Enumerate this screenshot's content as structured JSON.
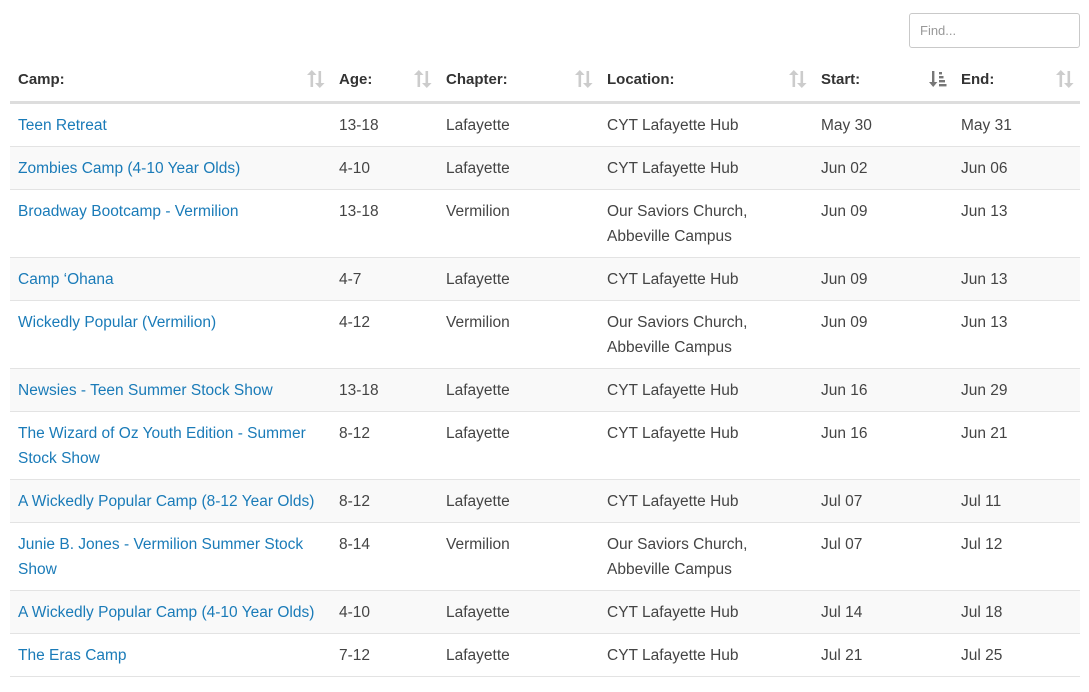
{
  "search": {
    "placeholder": "Find..."
  },
  "table": {
    "columns": [
      {
        "key": "camp",
        "label": "Camp:",
        "sort": "none"
      },
      {
        "key": "age",
        "label": "Age:",
        "sort": "none"
      },
      {
        "key": "chapter",
        "label": "Chapter:",
        "sort": "none"
      },
      {
        "key": "location",
        "label": "Location:",
        "sort": "none"
      },
      {
        "key": "start",
        "label": "Start:",
        "sort": "ascending"
      },
      {
        "key": "end",
        "label": "End:",
        "sort": "none"
      }
    ],
    "rows": [
      {
        "camp": "Teen Retreat",
        "age": "13-18",
        "chapter": "Lafayette",
        "location": "CYT Lafayette Hub",
        "start": "May 30",
        "end": "May 31"
      },
      {
        "camp": "Zombies Camp (4-10 Year Olds)",
        "age": "4-10",
        "chapter": "Lafayette",
        "location": "CYT Lafayette Hub",
        "start": "Jun 02",
        "end": "Jun 06"
      },
      {
        "camp": "Broadway Bootcamp - Vermilion",
        "age": "13-18",
        "chapter": "Vermilion",
        "location": "Our Saviors Church, Abbeville Campus",
        "start": "Jun 09",
        "end": "Jun 13"
      },
      {
        "camp": "Camp ‘Ohana",
        "age": "4-7",
        "chapter": "Lafayette",
        "location": "CYT Lafayette Hub",
        "start": "Jun 09",
        "end": "Jun 13"
      },
      {
        "camp": "Wickedly Popular (Vermilion)",
        "age": "4-12",
        "chapter": "Vermilion",
        "location": "Our Saviors Church, Abbeville Campus",
        "start": "Jun 09",
        "end": "Jun 13"
      },
      {
        "camp": "Newsies - Teen Summer Stock Show",
        "age": "13-18",
        "chapter": "Lafayette",
        "location": "CYT Lafayette Hub",
        "start": "Jun 16",
        "end": "Jun 29"
      },
      {
        "camp": "The Wizard of Oz Youth Edition - Summer Stock Show",
        "age": "8-12",
        "chapter": "Lafayette",
        "location": "CYT Lafayette Hub",
        "start": "Jun 16",
        "end": "Jun 21"
      },
      {
        "camp": "A Wickedly Popular Camp (8-12 Year Olds)",
        "age": "8-12",
        "chapter": "Lafayette",
        "location": "CYT Lafayette Hub",
        "start": "Jul 07",
        "end": "Jul 11"
      },
      {
        "camp": "Junie B. Jones - Vermilion Summer Stock Show",
        "age": "8-14",
        "chapter": "Vermilion",
        "location": "Our Saviors Church, Abbeville Campus",
        "start": "Jul 07",
        "end": "Jul 12"
      },
      {
        "camp": "A Wickedly Popular Camp (4-10 Year Olds)",
        "age": "4-10",
        "chapter": "Lafayette",
        "location": "CYT Lafayette Hub",
        "start": "Jul 14",
        "end": "Jul 18"
      },
      {
        "camp": "The Eras Camp",
        "age": "7-12",
        "chapter": "Lafayette",
        "location": "CYT Lafayette Hub",
        "start": "Jul 21",
        "end": "Jul 25"
      }
    ]
  },
  "colors": {
    "link": "#1a7bb8",
    "header_border": "#dddddd",
    "row_alt": "#f9f9f9",
    "sort_icon_inactive": "#cccccc",
    "sort_icon_active": "#777777"
  },
  "icons": {
    "sort_none": "sort-icon",
    "sort_ascending": "sort-amount-asc-icon"
  }
}
